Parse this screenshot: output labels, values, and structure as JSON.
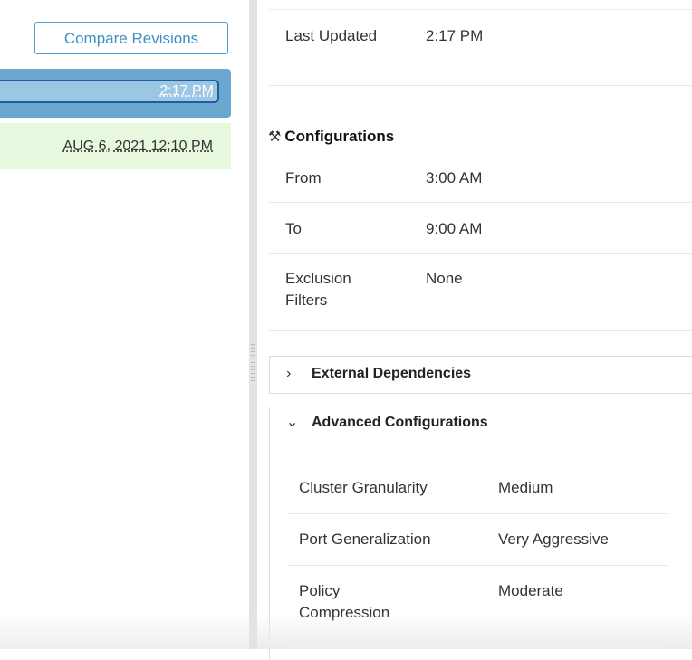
{
  "revisions": {
    "compare_label": "Compare Revisions",
    "items": [
      {
        "label": "2:17 PM",
        "selected": true
      },
      {
        "label": "AUG 6, 2021 12:10 PM",
        "selected": false
      }
    ]
  },
  "details": {
    "last_updated_label": "Last Updated",
    "last_updated_value": "2:17 PM",
    "configurations": {
      "title": "Configurations",
      "icon": "tools-icon",
      "rows": [
        {
          "label": "From",
          "value": "3:00 AM"
        },
        {
          "label": "To",
          "value": "9:00 AM"
        },
        {
          "label": "Exclusion Filters",
          "value": "None"
        }
      ]
    },
    "external_dependencies": {
      "title": "External Dependencies",
      "expanded": false
    },
    "advanced": {
      "title": "Advanced Configurations",
      "expanded": true,
      "rows": [
        {
          "label": "Cluster Granularity",
          "value": "Medium"
        },
        {
          "label": "Port Generalization",
          "value": "Very Aggressive"
        },
        {
          "label": "Policy Compression",
          "value": "Moderate"
        }
      ]
    }
  },
  "colors": {
    "accent": "#3d8fc4",
    "selected_revision_bg": "#6aa7cf",
    "older_revision_bg": "#e8f8de"
  }
}
